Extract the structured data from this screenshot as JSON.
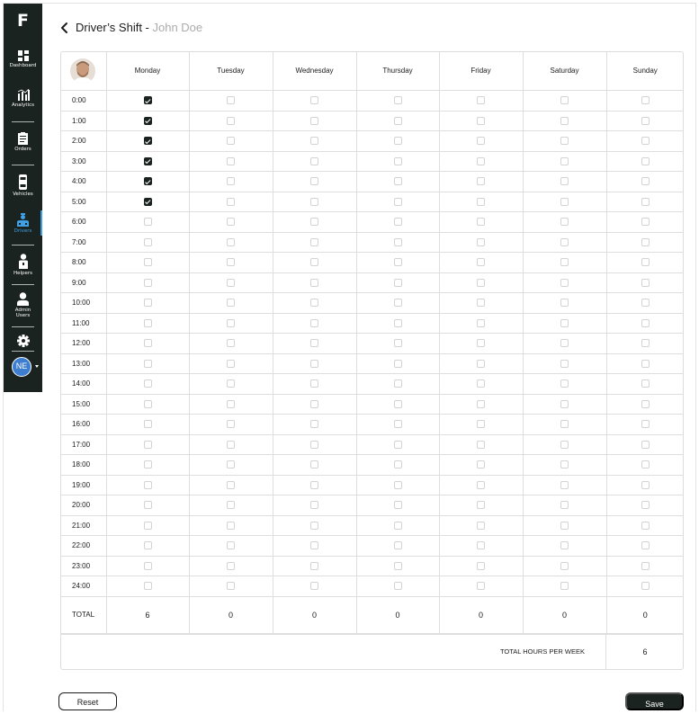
{
  "sidebar": {
    "logo": "F",
    "items": [
      {
        "label": "Dashboard",
        "icon": "dashboard-icon"
      },
      {
        "label": "Analytics",
        "icon": "analytics-icon"
      },
      {
        "label": "Orders",
        "icon": "orders-icon"
      },
      {
        "label": "Vehicles",
        "icon": "vehicle-icon"
      },
      {
        "label": "Drivers",
        "icon": "driver-icon",
        "active": true
      },
      {
        "label": "Helpers",
        "icon": "helper-icon"
      },
      {
        "label": "Admin Users",
        "icon": "admin-user-icon"
      }
    ],
    "settings_icon": "gear-icon",
    "user_initials": "NE",
    "accent_color": "#3fa0e6",
    "background_color": "#1b2321"
  },
  "header": {
    "title": "Driver’s Shift - ",
    "driver_name": "John Doe"
  },
  "schedule": {
    "days": [
      "Monday",
      "Tuesday",
      "Wednesday",
      "Thursday",
      "Friday",
      "Saturday",
      "Sunday"
    ],
    "hours": [
      "0:00",
      "1:00",
      "2:00",
      "3:00",
      "4:00",
      "5:00",
      "6:00",
      "7:00",
      "8:00",
      "9:00",
      "10:00",
      "11:00",
      "12:00",
      "13:00",
      "14:00",
      "15:00",
      "16:00",
      "17:00",
      "18:00",
      "19:00",
      "20:00",
      "21:00",
      "22:00",
      "23:00",
      "24:00"
    ],
    "checked": {
      "Monday": [
        "0:00",
        "1:00",
        "2:00",
        "3:00",
        "4:00",
        "5:00"
      ]
    },
    "total_label": "TOTAL",
    "totals": [
      "6",
      "0",
      "0",
      "0",
      "0",
      "0",
      "0"
    ],
    "week_total_label": "TOTAL HOURS PER WEEK",
    "week_total": "6"
  },
  "actions": {
    "reset_label": "Reset",
    "save_label": "Save"
  }
}
